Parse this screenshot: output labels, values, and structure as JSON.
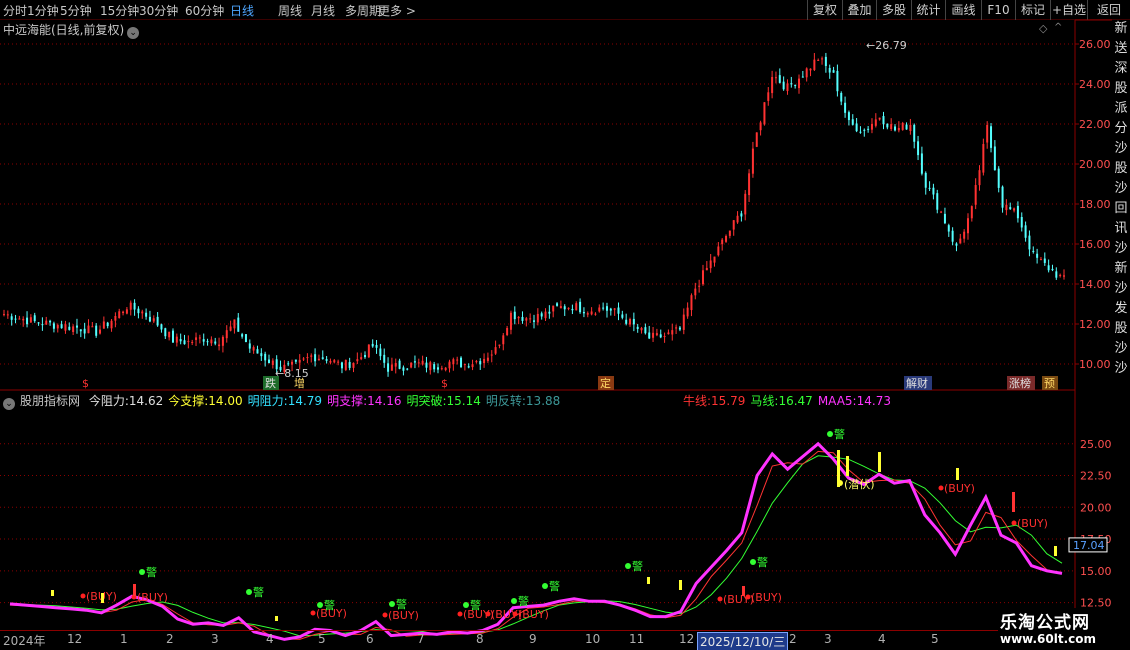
{
  "toolbar": {
    "periods": [
      "分时",
      "1分钟",
      "5分钟",
      "15分钟",
      "30分钟",
      "60分钟",
      "日线",
      "周线",
      "月线",
      "多周期",
      "更多 >"
    ],
    "active_period": "日线",
    "right_buttons": [
      "复权",
      "叠加",
      "多股",
      "统计",
      "画线",
      "F10",
      "标记",
      "+自选",
      "返回"
    ]
  },
  "main_panel": {
    "title": "中远海能(日线,前复权)",
    "high_label": "26.79",
    "low_label": "8.15",
    "y_ticks": [
      "26.00",
      "24.00",
      "22.00",
      "20.00",
      "18.00",
      "16.00",
      "14.00",
      "12.00",
      "10.00"
    ],
    "event_markers": [
      "$",
      "跌",
      "增",
      "$",
      "定",
      "解财",
      "涨榜",
      "预"
    ]
  },
  "right_edge_chars": [
    "新",
    "送",
    "深",
    "股",
    "派",
    "分",
    "沙",
    "股",
    "沙",
    "回",
    "讯",
    "沙",
    "新",
    "沙",
    "发",
    "股",
    "沙",
    "沙"
  ],
  "indicator_panel": {
    "name": "股朋指标网",
    "values": [
      {
        "label": "今阻力:",
        "value": "14.62",
        "color": "#e0e0e0"
      },
      {
        "label": "今支撑:",
        "value": "14.00",
        "color": "#ffff33"
      },
      {
        "label": "明阻力:",
        "value": "14.79",
        "color": "#33e0ff"
      },
      {
        "label": "明支撑:",
        "value": "14.16",
        "color": "#ff33ff"
      },
      {
        "label": "明突破:",
        "value": "15.14",
        "color": "#33ff33"
      },
      {
        "label": "明反转:",
        "value": "13.88",
        "color": "#3d9999"
      }
    ],
    "right_values": [
      {
        "label": "牛线:",
        "value": "15.79",
        "color": "#ff3333"
      },
      {
        "label": "马线:",
        "value": "16.47",
        "color": "#33ff33"
      },
      {
        "label": "MAA5:",
        "value": "14.73",
        "color": "#ff33ff"
      }
    ],
    "y_ticks": [
      "25.00",
      "22.50",
      "20.00",
      "17.50",
      "15.00",
      "12.50"
    ],
    "current_value": "17.04",
    "buy_label": "(BUY)",
    "warn_label": "警",
    "hide_label": "(潜伏)"
  },
  "date_axis": {
    "labels": [
      "2024年",
      "12",
      "1",
      "2",
      "3",
      "4",
      "5",
      "6",
      "7",
      "8",
      "9",
      "10",
      "11",
      "12",
      "2025/12/10/三",
      "2",
      "3",
      "4",
      "5"
    ],
    "selected": "2025/12/10/三"
  },
  "brand": {
    "name": "乐淘公式网",
    "url": "www.60lt.com"
  },
  "colors": {
    "up": "#ff3232",
    "down": "#54ffff",
    "grid": "#8b0000",
    "magenta": "#ff33ff",
    "ma_red": "#ff3333",
    "ma_green": "#33ff33"
  },
  "chart_data": {
    "type": "candlestick",
    "title": "中远海能(日线,前复权)",
    "ylim": [
      9,
      27
    ],
    "x": [
      "2024-11",
      "2024-12",
      "2025-01",
      "2025-02",
      "2025-03",
      "2025-04",
      "2025-05",
      "2025-06",
      "2025-07",
      "2025-08",
      "2025-09",
      "2025-10",
      "2025-11",
      "2025-12",
      "2026-01",
      "2026-02",
      "2026-03",
      "2026-04",
      "2026-05"
    ],
    "close_path": [
      12.5,
      12.3,
      12.1,
      12.0,
      11.9,
      11.8,
      11.6,
      12.2,
      12.9,
      12.6,
      12.0,
      11.2,
      11.1,
      11.3,
      11.2,
      12.0,
      10.8,
      10.3,
      9.8,
      9.9,
      10.4,
      10.3,
      9.9,
      10.2,
      10.9,
      9.8,
      9.9,
      10.0,
      9.9,
      10.1,
      10.0,
      10.2,
      10.7,
      12.5,
      12.3,
      12.4,
      12.8,
      12.9,
      12.7,
      12.8,
      12.5,
      11.9,
      11.3,
      11.4,
      11.7,
      13.8,
      15.1,
      16.4,
      17.6,
      21.5,
      24.5,
      23.8,
      24.5,
      25.3,
      24.4,
      22.0,
      21.7,
      22.4,
      21.7,
      22.0,
      19.0,
      17.6,
      15.8,
      17.7,
      21.8,
      18.0,
      17.4,
      15.4,
      14.8,
      14.2
    ],
    "high": 26.79,
    "low": 8.15,
    "indicator_line": [
      12.4,
      12.3,
      12.2,
      12.1,
      12.0,
      11.9,
      11.7,
      12.3,
      13.0,
      12.7,
      12.2,
      11.2,
      10.8,
      10.9,
      10.7,
      11.3,
      10.2,
      9.9,
      9.6,
      9.8,
      10.4,
      10.3,
      9.9,
      10.3,
      11.0,
      9.9,
      10.0,
      10.1,
      10.0,
      10.2,
      10.1,
      10.3,
      10.8,
      12.1,
      12.2,
      12.3,
      12.6,
      12.8,
      12.6,
      12.6,
      12.3,
      11.9,
      11.4,
      11.4,
      11.8,
      14.0,
      15.3,
      16.6,
      18.0,
      22.5,
      24.2,
      23.0,
      24.0,
      25.0,
      23.8,
      22.3,
      21.8,
      22.6,
      21.9,
      22.1,
      19.4,
      18.0,
      16.3,
      18.6,
      20.8,
      17.8,
      17.2,
      15.4,
      15.0,
      14.8
    ]
  }
}
